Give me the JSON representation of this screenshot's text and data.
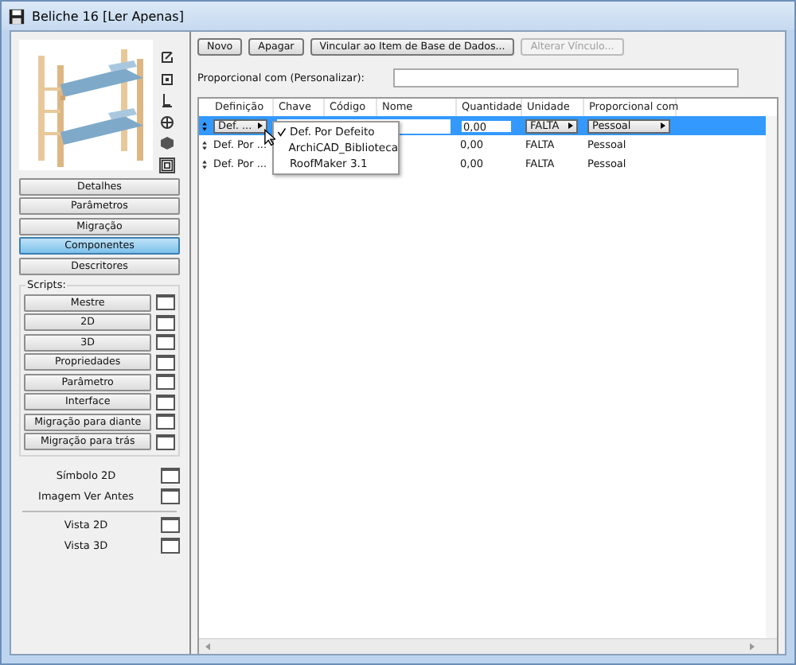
{
  "window": {
    "title": "Beliche 16 [Ler Apenas]"
  },
  "preview": {
    "kind": "picture"
  },
  "sections": [
    {
      "label": "Detalhes",
      "selected": false
    },
    {
      "label": "Parâmetros",
      "selected": false
    },
    {
      "label": "Migração",
      "selected": false
    },
    {
      "label": "Componentes",
      "selected": true
    },
    {
      "label": "Descritores",
      "selected": false
    }
  ],
  "scripts": {
    "title": "Scripts:",
    "items": [
      "Mestre",
      "2D",
      "3D",
      "Propriedades",
      "Parâmetro",
      "Interface",
      "Migração para diante",
      "Migração para trás"
    ]
  },
  "extras": [
    "Símbolo 2D",
    "Imagem Ver Antes"
  ],
  "views": [
    "Vista 2D",
    "Vista 3D"
  ],
  "buttons": [
    {
      "label": "Novo",
      "disabled": false
    },
    {
      "label": "Apagar",
      "disabled": false
    },
    {
      "label": "Vincular ao Item de Base de Dados...",
      "disabled": false
    },
    {
      "label": "Alterar Vínculo...",
      "disabled": true
    }
  ],
  "proportional": {
    "label": "Proporcional com (Personalizar):"
  },
  "table": {
    "columns": [
      "Definição",
      "Chave",
      "Código",
      "Nome",
      "Quantidade",
      "Unidade",
      "Proporcional com"
    ],
    "rows": [
      {
        "definition": "Def. ...",
        "quantity": "0,00",
        "unit": "FALTA",
        "proportional": "Pessoal",
        "selected": true
      },
      {
        "definition": "Def. Por ...",
        "quantity": "0,00",
        "unit": "FALTA",
        "proportional": "Pessoal",
        "selected": false
      },
      {
        "definition": "Def. Por ...",
        "quantity": "0,00",
        "unit": "FALTA",
        "proportional": "Pessoal",
        "selected": false
      }
    ]
  },
  "dropdown": [
    {
      "label": "Def. Por Defeito",
      "checked": true
    },
    {
      "label": "ArchiCAD_Biblioteca",
      "checked": false
    },
    {
      "label": "RoofMaker 3.1",
      "checked": false
    }
  ]
}
